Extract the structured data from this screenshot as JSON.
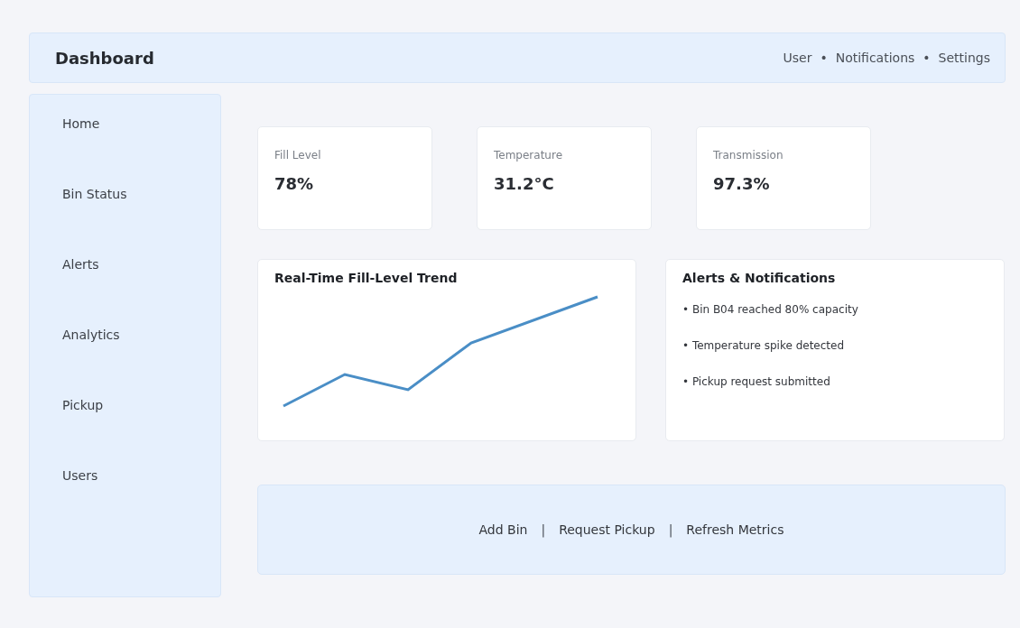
{
  "header": {
    "title": "Dashboard",
    "links": [
      "User",
      "Notifications",
      "Settings"
    ],
    "separator": "•"
  },
  "sidebar": {
    "items": [
      {
        "label": "Home",
        "selected": false
      },
      {
        "label": "Bin Status",
        "selected": false
      },
      {
        "label": "Alerts",
        "selected": false
      },
      {
        "label": "Analytics",
        "selected": false
      },
      {
        "label": "Pickup",
        "selected": false
      },
      {
        "label": "Users",
        "selected": false
      }
    ]
  },
  "metrics": [
    {
      "label": "Fill Level",
      "value": "78%"
    },
    {
      "label": "Temperature",
      "value": "31.2°C"
    },
    {
      "label": "Transmission",
      "value": "97.3%"
    }
  ],
  "trend": {
    "title": "Real-Time Fill-Level Trend"
  },
  "alerts": {
    "title": "Alerts & Notifications",
    "bullet": "•",
    "items": [
      "Bin B04 reached 80% capacity",
      "Temperature spike detected",
      "Pickup request submitted"
    ]
  },
  "actions": {
    "separator": "|",
    "items": [
      "Add Bin",
      "Request Pickup",
      "Refresh Metrics"
    ]
  }
}
